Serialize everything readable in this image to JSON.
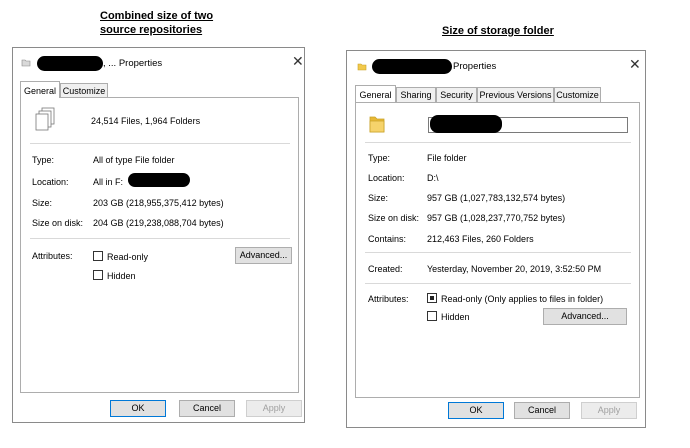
{
  "captions": {
    "left_line1": "Combined size of two",
    "left_line2": "source repositories",
    "right": "Size of storage folder"
  },
  "left_dialog": {
    "title_suffix": ", ... Properties",
    "tabs": [
      "General",
      "Customize"
    ],
    "active_tab": "General",
    "summary": "24,514 Files, 1,964 Folders",
    "type_label": "Type:",
    "type_value": "All of type File folder",
    "location_label": "Location:",
    "location_value": "All in F:",
    "size_label": "Size:",
    "size_value": "203 GB (218,955,375,412 bytes)",
    "size_on_disk_label": "Size on disk:",
    "size_on_disk_value": "204 GB (219,238,088,704 bytes)",
    "attributes_label": "Attributes:",
    "readonly_label": "Read-only",
    "hidden_label": "Hidden",
    "advanced_button": "Advanced...",
    "ok_button": "OK",
    "cancel_button": "Cancel",
    "apply_button": "Apply"
  },
  "right_dialog": {
    "title_suffix": "Properties",
    "tabs": [
      "General",
      "Sharing",
      "Security",
      "Previous Versions",
      "Customize"
    ],
    "active_tab": "General",
    "type_label": "Type:",
    "type_value": "File folder",
    "location_label": "Location:",
    "location_value": "D:\\",
    "size_label": "Size:",
    "size_value": "957 GB (1,027,783,132,574 bytes)",
    "size_on_disk_label": "Size on disk:",
    "size_on_disk_value": "957 GB (1,028,237,770,752 bytes)",
    "contains_label": "Contains:",
    "contains_value": "212,463 Files, 260 Folders",
    "created_label": "Created:",
    "created_value": "Yesterday, November 20, 2019, 3:52:50 PM",
    "attributes_label": "Attributes:",
    "readonly_label": "Read-only (Only applies to files in folder)",
    "hidden_label": "Hidden",
    "advanced_button": "Advanced...",
    "ok_button": "OK",
    "cancel_button": "Cancel",
    "apply_button": "Apply"
  },
  "icons": {
    "files_icon": "multiple-files-icon",
    "folder_icon": "folder-icon",
    "close_icon": "close-icon"
  },
  "colors": {
    "folder_yellow": "#f2c94c",
    "default_button_border": "#0078d7",
    "redaction": "#000000"
  }
}
